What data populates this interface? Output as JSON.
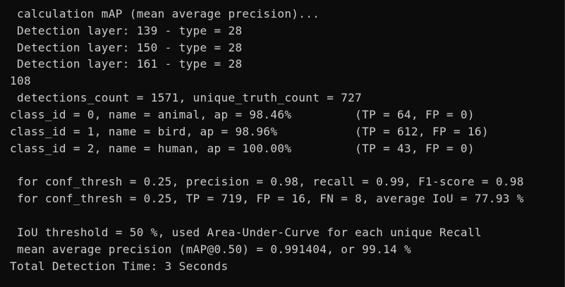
{
  "console": {
    "lines": [
      " calculation mAP (mean average precision)...",
      " Detection layer: 139 - type = 28",
      " Detection layer: 150 - type = 28",
      " Detection layer: 161 - type = 28",
      "108",
      " detections_count = 1571, unique_truth_count = 727",
      "class_id = 0, name = animal, ap = 98.46%         (TP = 64, FP = 0)",
      "class_id = 1, name = bird, ap = 98.96%           (TP = 612, FP = 16)",
      "class_id = 2, name = human, ap = 100.00%         (TP = 43, FP = 0)",
      "",
      " for conf_thresh = 0.25, precision = 0.98, recall = 0.99, F1-score = 0.98",
      " for conf_thresh = 0.25, TP = 719, FP = 16, FN = 8, average IoU = 77.93 %",
      "",
      " IoU threshold = 50 %, used Area-Under-Curve for each unique Recall",
      " mean average precision (mAP@0.50) = 0.991404, or 99.14 %",
      "Total Detection Time: 3 Seconds"
    ]
  },
  "colors": {
    "background": "#0c0c0c",
    "text": "#cccccc"
  }
}
